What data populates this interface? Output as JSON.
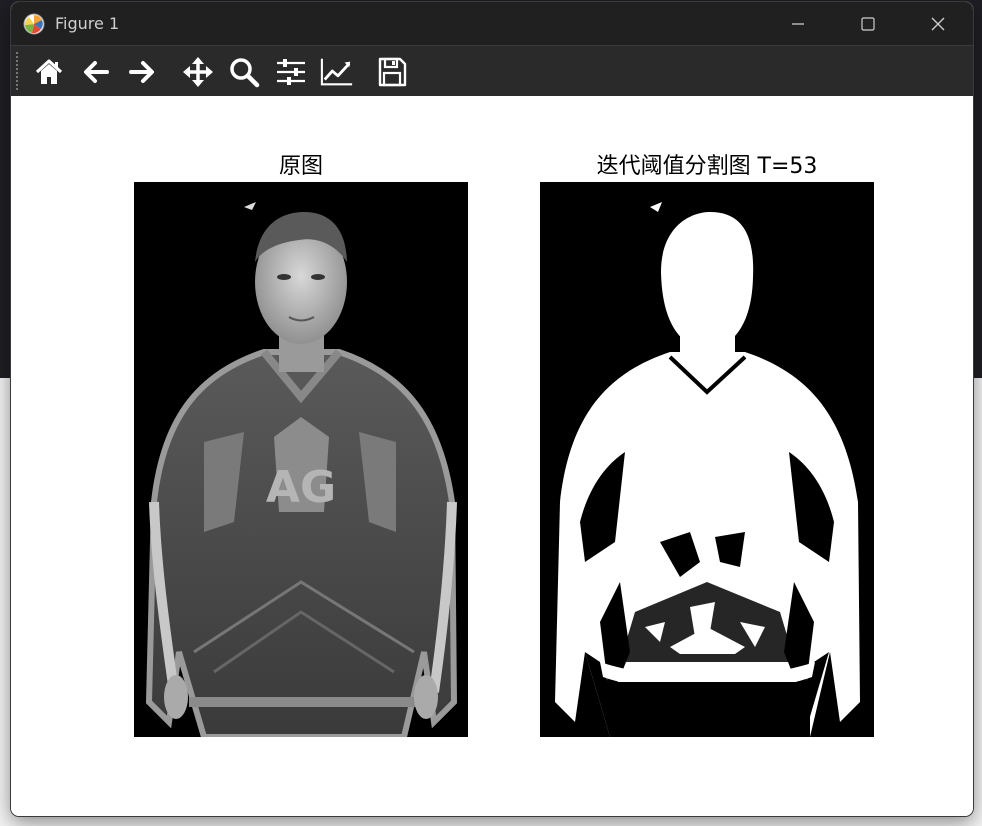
{
  "window": {
    "title": "Figure 1",
    "controls": [
      "minimize",
      "maximize",
      "close"
    ]
  },
  "toolbar": {
    "tools": [
      {
        "name": "home",
        "icon": "home-icon"
      },
      {
        "name": "back",
        "icon": "arrow-left-icon"
      },
      {
        "name": "forward",
        "icon": "arrow-right-icon"
      },
      {
        "name": "pan",
        "icon": "move-icon"
      },
      {
        "name": "zoom",
        "icon": "magnifier-icon"
      },
      {
        "name": "configure-subplots",
        "icon": "sliders-icon"
      },
      {
        "name": "edit-axes",
        "icon": "line-chart-icon"
      },
      {
        "name": "save",
        "icon": "floppy-disk-icon"
      }
    ]
  },
  "figure": {
    "left_title": "原图",
    "right_title": "迭代阈值分割图 T=53"
  }
}
